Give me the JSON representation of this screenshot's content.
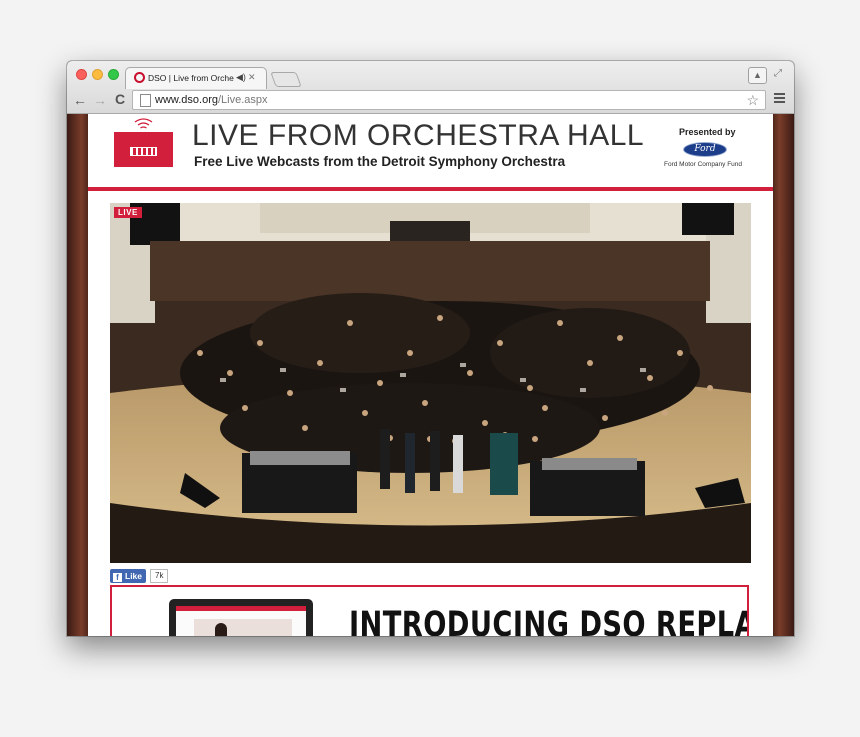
{
  "browser": {
    "tab_title": "DSO | Live from Orches",
    "url_host": "www.dso.org",
    "url_path": "/Live.aspx",
    "icons": [
      "close-window",
      "minimize-window",
      "zoom-window",
      "tab-favicon",
      "audio-playing-icon",
      "tab-close-icon",
      "profile-icon",
      "fullscreen-icon",
      "back-arrow-icon",
      "forward-arrow-icon",
      "reload-icon",
      "page-icon",
      "bookmark-star-icon",
      "hamburger-menu-icon"
    ]
  },
  "header": {
    "title": "LIVE FROM ORCHESTRA HALL",
    "subtitle": "Free Live Webcasts from the Detroit Symphony Orchestra",
    "presented_by": "Presented by",
    "sponsor_logo_text": "Ford",
    "sponsor_name": "Ford Motor Company Fund"
  },
  "video": {
    "badge": "LIVE"
  },
  "social": {
    "like_label": "Like",
    "like_count": "7k"
  },
  "promo": {
    "headline": "INTRODUCING DSO REPLAY"
  },
  "colors": {
    "brand_red": "#d21f3c",
    "facebook_blue": "#4267b2",
    "ford_blue": "#1c3d8a"
  }
}
